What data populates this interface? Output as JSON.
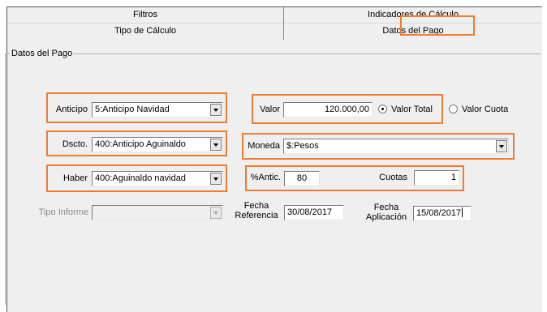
{
  "tabs": {
    "row1": [
      "Filtros",
      "Indicadores de Cálculo"
    ],
    "row2": [
      "Tipo de Cálculo",
      "Datos del Pago"
    ],
    "selected": "Datos del Pago"
  },
  "group": {
    "title": "Datos del Pago"
  },
  "anticipo": {
    "label": "Anticipo",
    "value": "5:Anticipo Navidad"
  },
  "dscto": {
    "label": "Dscto.",
    "value": "400:Anticipo Aguinaldo"
  },
  "haber": {
    "label": "Haber",
    "value": "400:Aguinaldo navidad"
  },
  "tipo_informe": {
    "label": "Tipo Informe",
    "value": ""
  },
  "valor": {
    "label": "Valor",
    "value": "120.000,00",
    "option_total": "Valor Total",
    "option_cuota": "Valor Cuota",
    "selected": "Valor Total"
  },
  "moneda": {
    "label": "Moneda",
    "value": "$:Pesos"
  },
  "antic": {
    "label": "%Antic.",
    "value": "80"
  },
  "cuotas": {
    "label": "Cuotas",
    "value": "1"
  },
  "fecha_referencia": {
    "label_1": "Fecha",
    "label_2": "Referencia",
    "value": "30/08/2017"
  },
  "fecha_aplicacion": {
    "label_1": "Fecha",
    "label_2": "Aplicación",
    "value": "15/08/2017"
  },
  "colors": {
    "highlight": "#ed7d31",
    "panel": "#efefef",
    "disabled_text": "#8a8a8a"
  }
}
